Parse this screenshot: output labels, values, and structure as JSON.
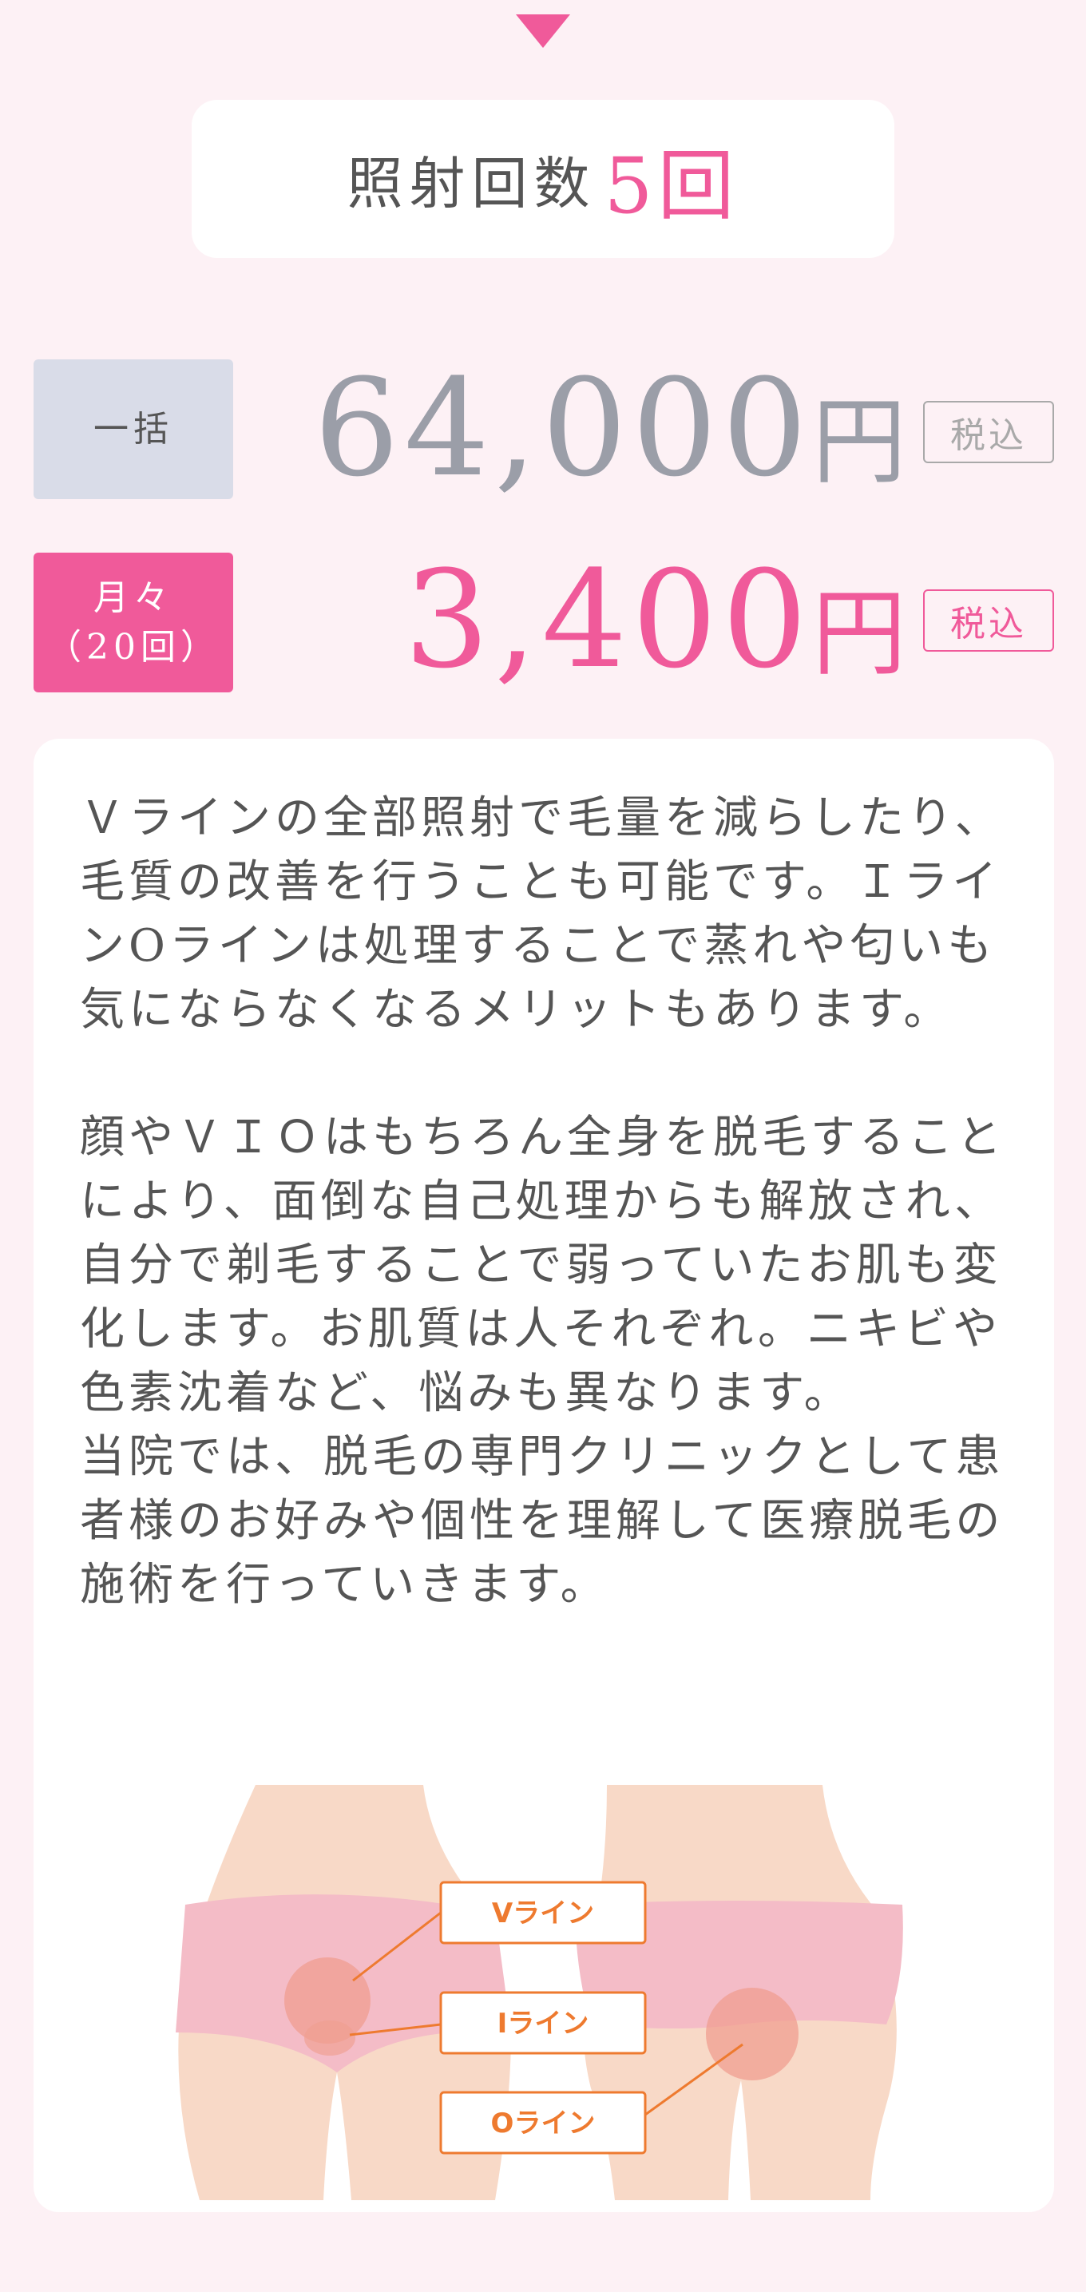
{
  "count": {
    "label": "照射回数",
    "value": "5回"
  },
  "plans": [
    {
      "label": "一括",
      "amount": "64,000",
      "yen": "円",
      "tax": "税込"
    },
    {
      "label_line1": "月々",
      "label_line2": "（20回）",
      "amount": "3,400",
      "yen": "円",
      "tax": "税込"
    }
  ],
  "description": {
    "para1": "Ｖラインの全部照射で毛量を減らしたり、毛質の改善を行うことも可能です。ＩラインOラインは処理することで蒸れや匂いも気にならなくなるメリットもあります。",
    "para2": "顔やＶＩＯはもちろん全身を脱毛することにより、面倒な自己処理からも解放され、自分で剃毛することで弱っていたお肌も変化します。お肌質は人それぞれ。ニキビや色素沈着など、悩みも異なります。",
    "para3": "当院では、脱毛の専門クリニックとして患者様のお好みや個性を理解して医療脱毛の施術を行っていきます。"
  },
  "diagram": {
    "v_line": "Vライン",
    "i_line": "Iライン",
    "o_line": "Oライン"
  },
  "colors": {
    "accent": "#f05a9a",
    "background": "#fdf1f5",
    "text": "#555555",
    "label_orange": "#ee7a2f"
  }
}
